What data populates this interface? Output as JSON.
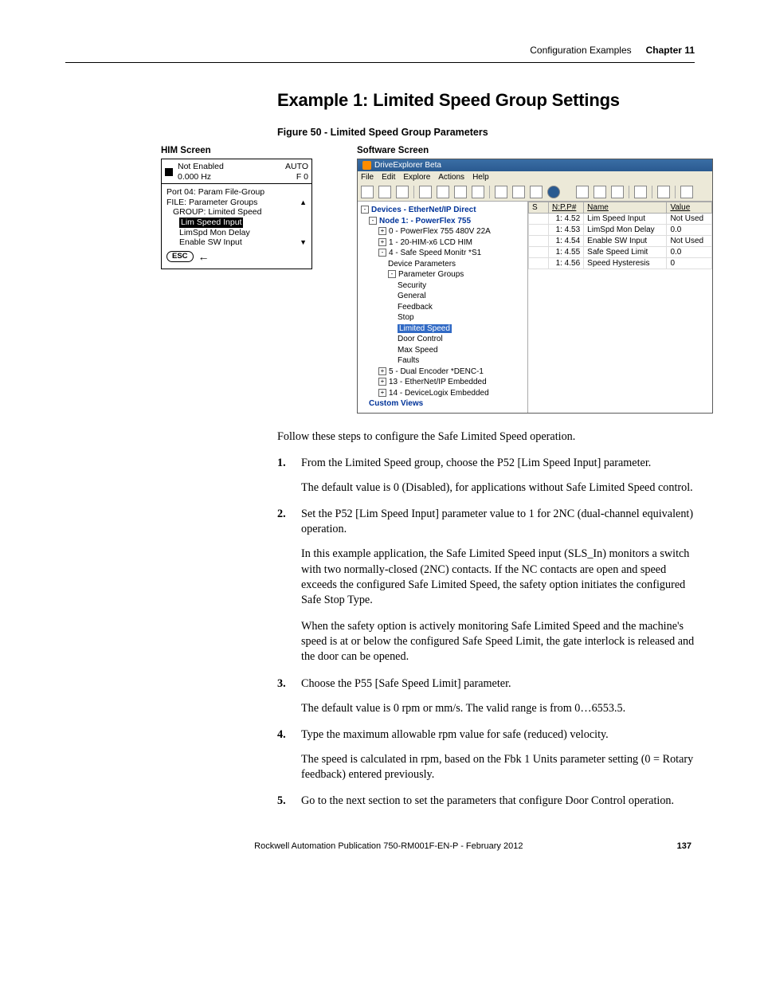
{
  "header": {
    "section": "Configuration Examples",
    "chapter": "Chapter 11"
  },
  "title": "Example 1: Limited Speed Group Settings",
  "figure_caption": "Figure 50 - Limited Speed Group Parameters",
  "him": {
    "label": "HIM Screen",
    "status_top": "Not Enabled",
    "status_hz": "0.000 Hz",
    "auto": "AUTO",
    "f0": "F 0",
    "port_line": "Port 04:   Param File-Group",
    "file_line": "FILE:  Parameter Groups",
    "group_line": "GROUP:  Limited Speed",
    "item_sel": "Lim Speed Input",
    "item2": "LimSpd Mon Delay",
    "item3": "Enable SW Input",
    "esc": "ESC"
  },
  "soft": {
    "label": "Software Screen",
    "title": "DriveExplorer Beta",
    "menus": [
      "File",
      "Edit",
      "Explore",
      "Actions",
      "Help"
    ],
    "tree": {
      "root": "Devices - EtherNet/IP Direct",
      "node1": "Node 1: - PowerFlex 755",
      "n0": "0  - PowerFlex 755 480V  22A",
      "n1": "1  - 20-HIM-x6 LCD HIM",
      "n4": "4  - Safe Speed Monitr *S1",
      "devparams": "Device Parameters",
      "paramgroups": "Parameter Groups",
      "grp": [
        "Security",
        "General",
        "Feedback",
        "Stop",
        "Limited Speed",
        "Door Control",
        "Max Speed",
        "Faults"
      ],
      "n5": "5  - Dual Encoder *DENC-1",
      "n13": "13  - EtherNet/IP Embedded",
      "n14": "14  - DeviceLogix Embedded",
      "custom": "Custom Views"
    },
    "grid": {
      "s_col": "S",
      "headers": [
        "N:P.P#",
        "Name",
        "Value"
      ],
      "rows": [
        {
          "np": "1: 4.52",
          "name": "Lim Speed Input",
          "value": "Not Used"
        },
        {
          "np": "1: 4.53",
          "name": "LimSpd Mon Delay",
          "value": "0.0"
        },
        {
          "np": "1: 4.54",
          "name": "Enable SW Input",
          "value": "Not Used"
        },
        {
          "np": "1: 4.55",
          "name": "Safe Speed Limit",
          "value": "0.0"
        },
        {
          "np": "1: 4.56",
          "name": "Speed Hysteresis",
          "value": "0"
        }
      ]
    }
  },
  "intro": "Follow these steps to configure the Safe Limited Speed operation.",
  "steps": [
    {
      "n": "1.",
      "lead": "From the Limited Speed group, choose the P52 [Lim Speed Input] parameter.",
      "subs": [
        "The default value is 0 (Disabled), for applications without Safe Limited Speed control."
      ]
    },
    {
      "n": "2.",
      "lead": "Set the P52 [Lim Speed Input] parameter value to 1 for 2NC (dual-channel equivalent) operation.",
      "subs": [
        "In this example application, the Safe Limited Speed input (SLS_In) monitors a switch with two normally-closed (2NC) contacts. If the NC contacts are open and speed exceeds the configured Safe Limited Speed, the safety option initiates the configured Safe Stop Type.",
        "When the safety option is actively monitoring Safe Limited Speed and the machine's speed is at or below the configured Safe Speed Limit, the gate interlock is released and the door can be opened."
      ]
    },
    {
      "n": "3.",
      "lead": "Choose the P55 [Safe Speed Limit] parameter.",
      "subs": [
        "The default value is 0 rpm or mm/s. The valid range is from 0…6553.5."
      ]
    },
    {
      "n": "4.",
      "lead": "Type the maximum allowable rpm value for safe (reduced) velocity.",
      "subs": [
        "The speed is calculated in rpm, based on the Fbk 1 Units parameter setting (0 = Rotary feedback) entered previously."
      ]
    },
    {
      "n": "5.",
      "lead": "Go to the next section to set the parameters that configure Door Control operation.",
      "subs": []
    }
  ],
  "footer": {
    "pub": "Rockwell Automation Publication 750-RM001F-EN-P - February 2012",
    "page": "137"
  }
}
